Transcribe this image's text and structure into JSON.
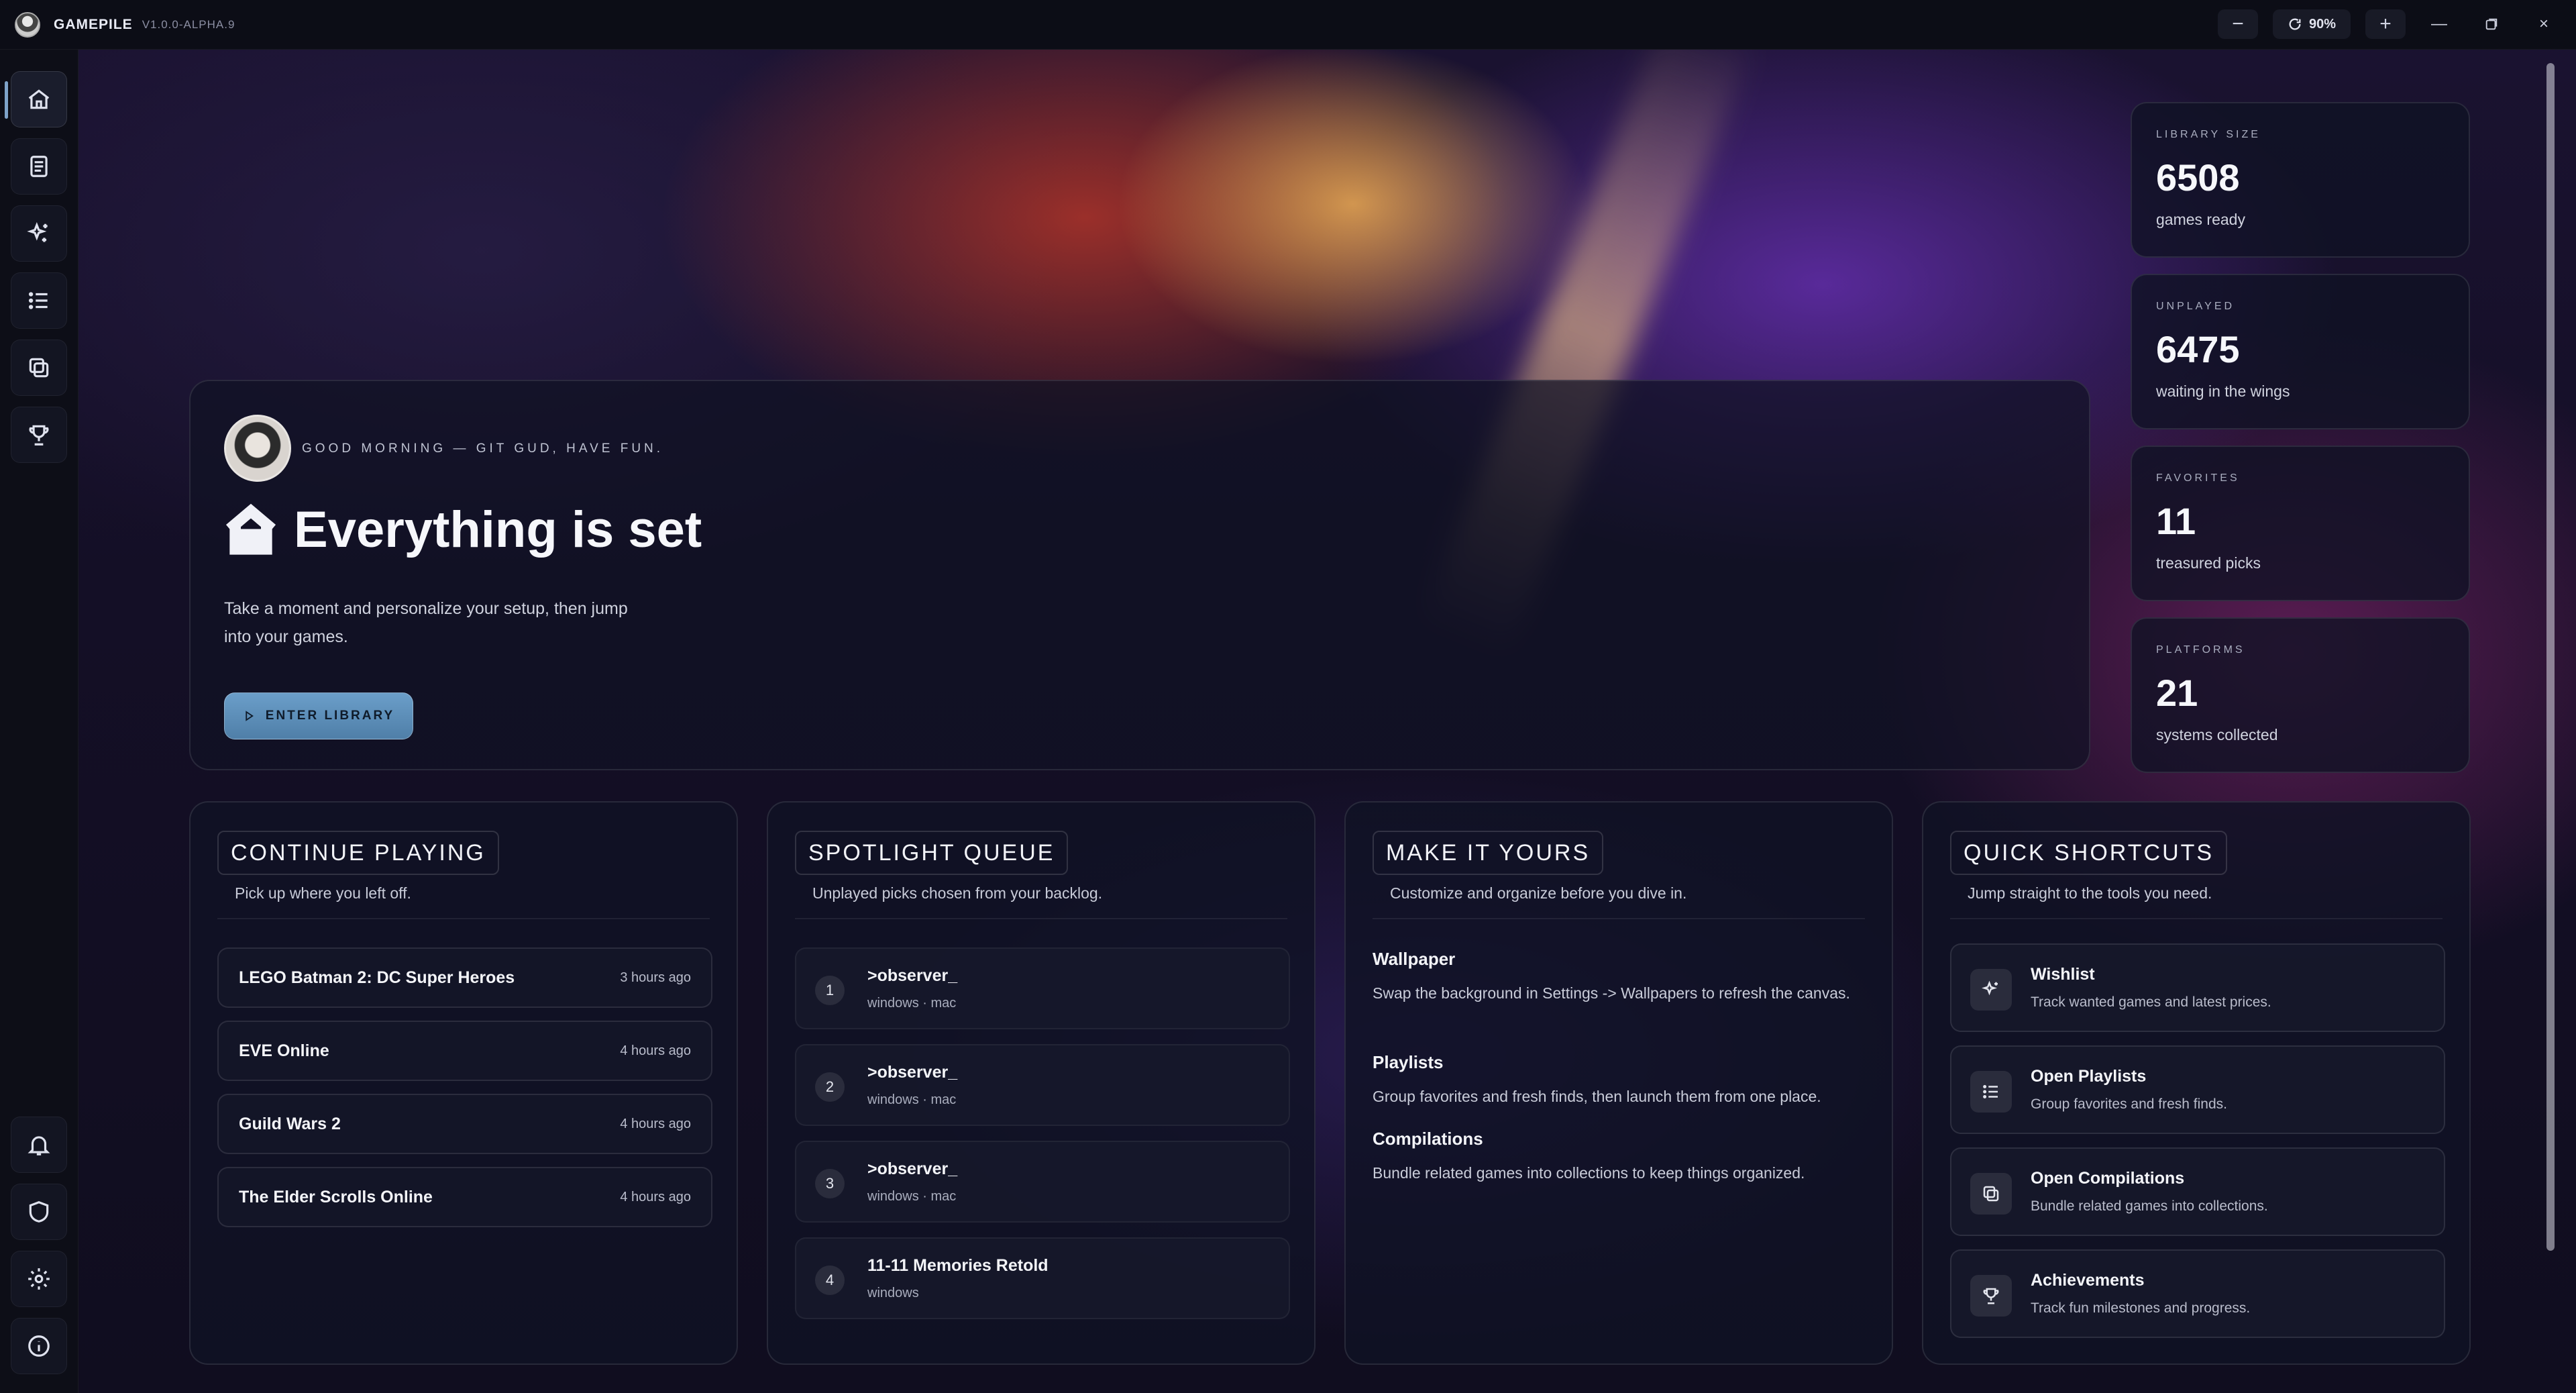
{
  "app": {
    "name": "GAMEPILE",
    "version": "V1.0.0-ALPHA.9"
  },
  "titlebar": {
    "zoom": "90%"
  },
  "hero": {
    "greeting": "GOOD MORNING — GIT GUD, HAVE FUN.",
    "title": "Everything is set",
    "description": "Take a moment and personalize your setup, then jump into your games.",
    "button": "ENTER LIBRARY"
  },
  "stats": [
    {
      "label": "LIBRARY SIZE",
      "value": "6508",
      "sub": "games ready"
    },
    {
      "label": "UNPLAYED",
      "value": "6475",
      "sub": "waiting in the wings"
    },
    {
      "label": "FAVORITES",
      "value": "11",
      "sub": "treasured picks"
    },
    {
      "label": "PLATFORMS",
      "value": "21",
      "sub": "systems collected"
    }
  ],
  "continue_playing": {
    "title": "CONTINUE PLAYING",
    "subtitle": "Pick up where you left off.",
    "items": [
      {
        "name": "LEGO Batman 2: DC Super Heroes",
        "time": "3 hours ago"
      },
      {
        "name": "EVE Online",
        "time": "4 hours ago"
      },
      {
        "name": "Guild Wars 2",
        "time": "4 hours ago"
      },
      {
        "name": "The Elder Scrolls Online",
        "time": "4 hours ago"
      }
    ]
  },
  "spotlight": {
    "title": "SPOTLIGHT QUEUE",
    "subtitle": "Unplayed picks chosen from your backlog.",
    "items": [
      {
        "num": "1",
        "name": ">observer_",
        "platforms": "windows · mac"
      },
      {
        "num": "2",
        "name": ">observer_",
        "platforms": "windows · mac"
      },
      {
        "num": "3",
        "name": ">observer_",
        "platforms": "windows · mac"
      },
      {
        "num": "4",
        "name": "11-11 Memories Retold",
        "platforms": "windows"
      }
    ]
  },
  "make_it_yours": {
    "title": "MAKE IT YOURS",
    "subtitle": "Customize and organize before you dive in.",
    "items": [
      {
        "head": "Wallpaper",
        "desc": "Swap the background in Settings -> Wallpapers to refresh the canvas."
      },
      {
        "head": "Playlists",
        "desc": "Group favorites and fresh finds, then launch them from one place."
      },
      {
        "head": "Compilations",
        "desc": "Bundle related games into collections to keep things organized."
      }
    ]
  },
  "quick_shortcuts": {
    "title": "QUICK SHORTCUTS",
    "subtitle": "Jump straight to the tools you need.",
    "items": [
      {
        "name": "Wishlist",
        "desc": "Track wanted games and latest prices.",
        "icon": "sparkles-icon"
      },
      {
        "name": "Open Playlists",
        "desc": "Group favorites and fresh finds.",
        "icon": "list-icon"
      },
      {
        "name": "Open Compilations",
        "desc": "Bundle related games into collections.",
        "icon": "stack-icon"
      },
      {
        "name": "Achievements",
        "desc": "Track fun milestones and progress.",
        "icon": "trophy-icon"
      }
    ]
  },
  "colors": {
    "accent": "#5f8fb9",
    "panel": "#10122a"
  }
}
